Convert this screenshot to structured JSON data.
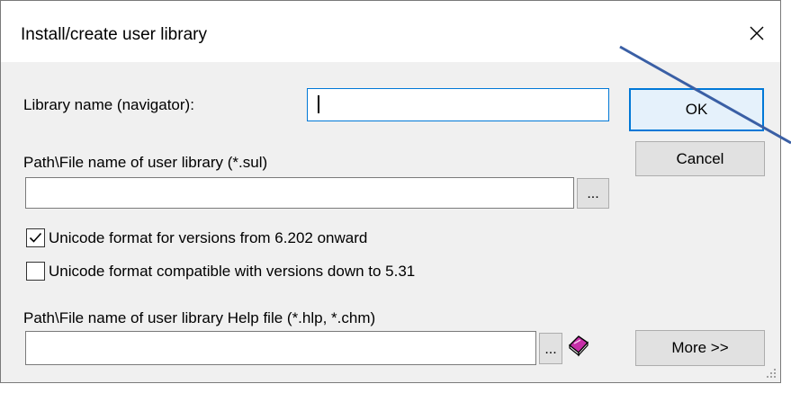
{
  "window": {
    "title": "Install/create user library",
    "close_symbol": "✕"
  },
  "form": {
    "library_name_label": "Library name (navigator):",
    "library_name_value": "",
    "path_label": "Path\\File name of user library (*.sul)",
    "path_value": "",
    "browse_label": "...",
    "unicode_new_label": "Unicode format for versions from 6.202 onward",
    "unicode_new_checked": true,
    "unicode_compat_label": "Unicode format compatible with versions down to 5.31",
    "unicode_compat_checked": false,
    "help_path_label": "Path\\File name of user library Help file (*.hlp, *.chm)",
    "help_path_value": "",
    "help_browse_label": "..."
  },
  "buttons": {
    "ok_label": "OK",
    "cancel_label": "Cancel",
    "more_label": "More >>"
  },
  "icons": {
    "close": "close-icon",
    "help_book": "help-book-icon",
    "checkmark": "checkmark-icon",
    "resize_grip": "resize-grip-icon"
  },
  "colors": {
    "dialog_bg": "#f0f0f0",
    "title_bg": "#ffffff",
    "focus_border": "#0078d7",
    "button_bg": "#e1e1e1",
    "annotation_arrow": "#3a5fa5",
    "help_book": "#c62fa8"
  }
}
